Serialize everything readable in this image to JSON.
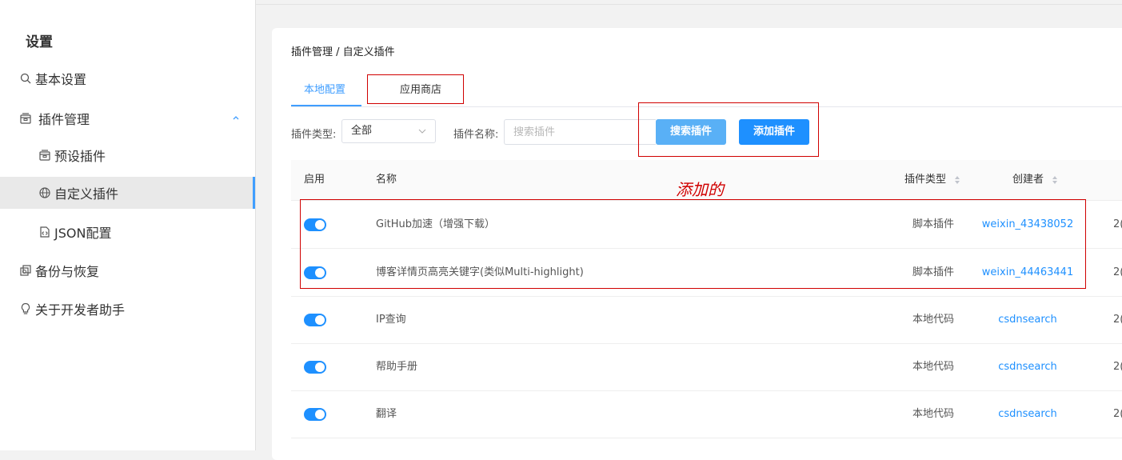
{
  "sidebar": {
    "title": "设置",
    "items": [
      {
        "label": "基本设置",
        "icon": "search-icon"
      },
      {
        "label": "插件管理",
        "icon": "package-icon",
        "expanded": true
      },
      {
        "label": "预设插件",
        "icon": "package-icon"
      },
      {
        "label": "自定义插件",
        "icon": "globe-icon",
        "active": true
      },
      {
        "label": "JSON配置",
        "icon": "file-json-icon"
      },
      {
        "label": "备份与恢复",
        "icon": "backup-icon"
      },
      {
        "label": "关于开发者助手",
        "icon": "lightbulb-icon"
      }
    ]
  },
  "breadcrumb": "插件管理 / 自定义插件",
  "tabs": [
    {
      "label": "本地配置",
      "active": true
    },
    {
      "label": "应用商店"
    }
  ],
  "filters": {
    "type_label": "插件类型:",
    "type_value": "全部",
    "name_label": "插件名称:",
    "name_placeholder": "搜索插件"
  },
  "buttons": {
    "search": "搜索插件",
    "add": "添加插件"
  },
  "table": {
    "headers": [
      "启用",
      "名称",
      "插件类型",
      "创建者"
    ],
    "rows": [
      {
        "enabled": true,
        "name": "GitHub加速（增强下载）",
        "type": "脚本插件",
        "creator": "weixin_43438052",
        "date_prefix": "2("
      },
      {
        "enabled": true,
        "name": "博客详情页高亮关键字(类似Multi-highlight)",
        "type": "脚本插件",
        "creator": "weixin_44463441",
        "date_prefix": "2("
      },
      {
        "enabled": true,
        "name": "IP查询",
        "type": "本地代码",
        "creator": "csdnsearch",
        "date_prefix": "2("
      },
      {
        "enabled": true,
        "name": "帮助手册",
        "type": "本地代码",
        "creator": "csdnsearch",
        "date_prefix": "2("
      },
      {
        "enabled": true,
        "name": "翻译",
        "type": "本地代码",
        "creator": "csdnsearch",
        "date_prefix": "2("
      }
    ]
  },
  "annotation": {
    "text": "添加的",
    "color": "#d00000"
  },
  "colors": {
    "accent": "#1e90ff",
    "search_button": "#59b0f6"
  }
}
